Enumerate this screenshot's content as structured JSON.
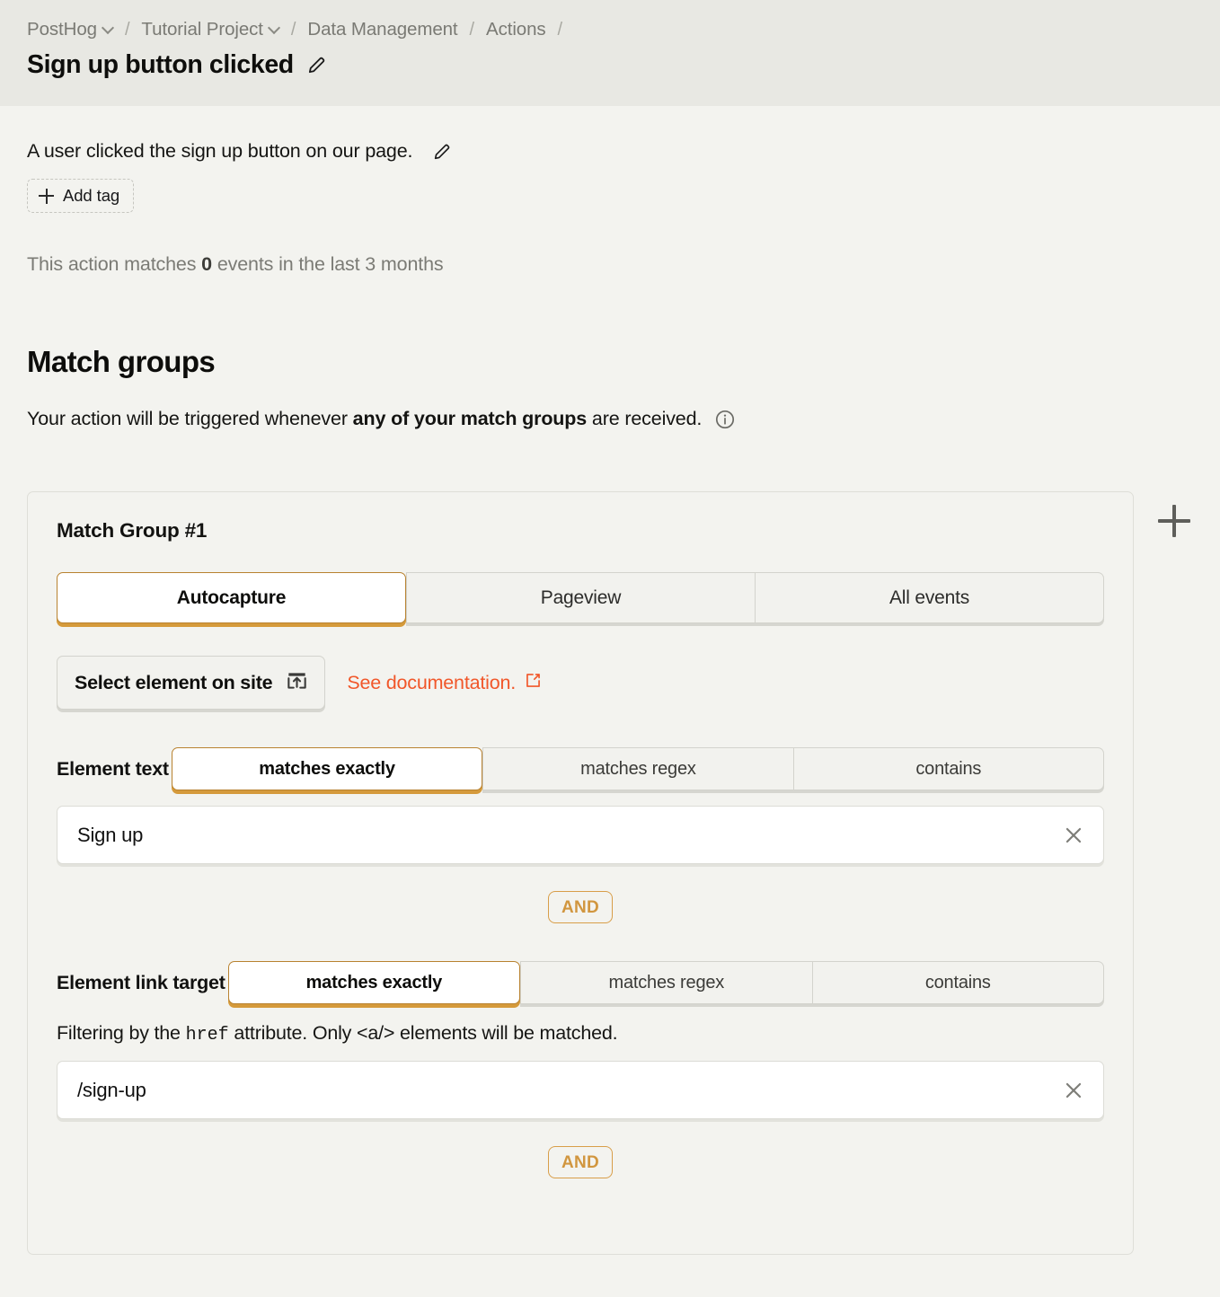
{
  "breadcrumb": {
    "items": [
      {
        "label": "PostHog",
        "has_chevron": true
      },
      {
        "label": "Tutorial Project",
        "has_chevron": true
      },
      {
        "label": "Data Management",
        "has_chevron": false
      },
      {
        "label": "Actions",
        "has_chevron": false
      }
    ],
    "separator": "/",
    "trailing_separator": "/"
  },
  "header": {
    "title": "Sign up button clicked",
    "edit_icon": "pencil-icon"
  },
  "description": {
    "text": "A user clicked the sign up button on our page.",
    "edit_icon": "pencil-icon",
    "add_tag_label": "Add tag",
    "add_tag_icon": "plus-icon"
  },
  "match_stats": {
    "prefix": "This action matches",
    "count": "0",
    "suffix": "events in the last 3 months"
  },
  "match_groups": {
    "title": "Match groups",
    "subtitle_prefix": "Your action will be triggered whenever",
    "subtitle_bold": "any of your match groups",
    "subtitle_suffix": "are received.",
    "info_icon": "info-icon",
    "add_group_icon": "plus-icon",
    "group": {
      "title": "Match Group #1",
      "event_type_tabs": [
        {
          "label": "Autocapture",
          "active": true
        },
        {
          "label": "Pageview",
          "active": false
        },
        {
          "label": "All events",
          "active": false
        }
      ],
      "select_element_label": "Select element on site",
      "select_element_icon": "select-element-icon",
      "doc_link_label": "See documentation.",
      "doc_link_icon": "external-link-icon",
      "filters": [
        {
          "label": "Element text",
          "operators": [
            {
              "label": "matches exactly",
              "active": true
            },
            {
              "label": "matches regex",
              "active": false
            },
            {
              "label": "contains",
              "active": false
            }
          ],
          "value": "Sign up",
          "placeholder": "",
          "hint": null,
          "clear_icon": "close-icon"
        },
        {
          "label": "Element link target",
          "operators": [
            {
              "label": "matches exactly",
              "active": true
            },
            {
              "label": "matches regex",
              "active": false
            },
            {
              "label": "contains",
              "active": false
            }
          ],
          "value": "/sign-up",
          "placeholder": "",
          "hint_prefix": "Filtering by the",
          "hint_code": "href",
          "hint_suffix": "attribute. Only <a/> elements will be matched.",
          "clear_icon": "close-icon"
        }
      ],
      "and_label": "AND"
    }
  },
  "colors": {
    "header_bg": "#e8e8e3",
    "body_bg": "#f3f3ef",
    "accent_orange": "#f1572a",
    "accent_amber": "#b88230",
    "and_amber": "#d89e49",
    "muted_text": "#7b7b75"
  }
}
